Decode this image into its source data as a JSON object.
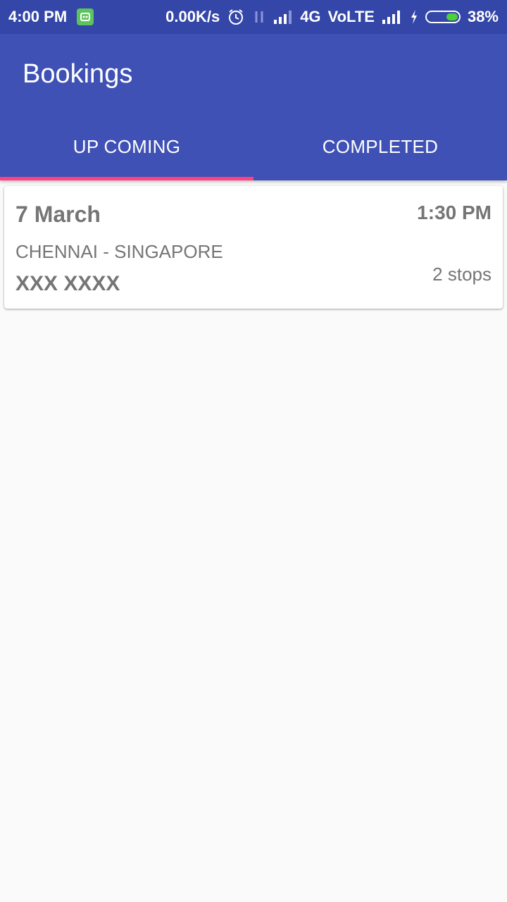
{
  "status_bar": {
    "time": "4:00 PM",
    "speed": "0.00K/s",
    "network": "4G",
    "volte": "VoLTE",
    "battery": "38%",
    "battery_level": 0.38,
    "icons": [
      "app-notification-icon",
      "alarm-icon",
      "data-arrows-icon",
      "signal-icon",
      "signal-icon",
      "charging-icon",
      "battery-icon"
    ]
  },
  "app_bar": {
    "title": "Bookings",
    "background": "#3f51b5"
  },
  "tabs": [
    {
      "label": "UP COMING",
      "active": true
    },
    {
      "label": "COMPLETED",
      "active": false
    }
  ],
  "tab_indicator_color": "#ff4081",
  "bookings": [
    {
      "date": "7 March",
      "time": "1:30 PM",
      "route": "CHENNAI - SINGAPORE",
      "name": "XXX XXXX",
      "stops": "2 stops"
    }
  ]
}
